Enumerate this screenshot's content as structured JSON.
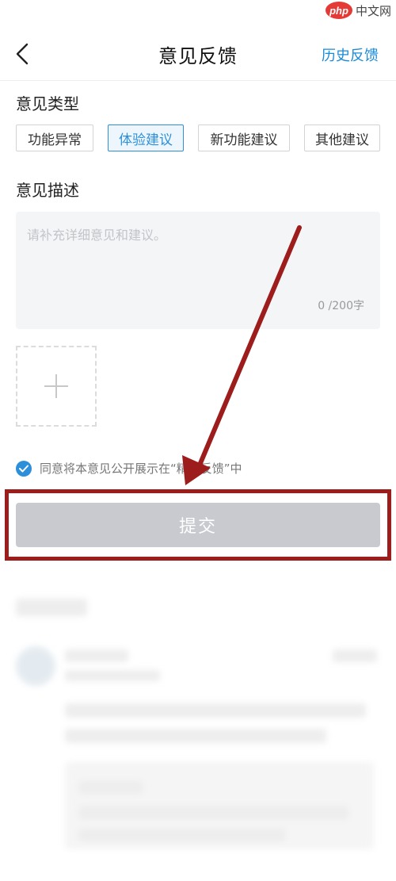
{
  "watermark": {
    "logo": "php",
    "text": "中文网"
  },
  "header": {
    "title": "意见反馈",
    "history_label": "历史反馈"
  },
  "feedback_type": {
    "label": "意见类型",
    "options": [
      {
        "label": "功能异常",
        "selected": false
      },
      {
        "label": "体验建议",
        "selected": true
      },
      {
        "label": "新功能建议",
        "selected": false
      },
      {
        "label": "其他建议",
        "selected": false
      }
    ]
  },
  "description": {
    "label": "意见描述",
    "placeholder": "请补充详细意见和建议。",
    "value": "",
    "counter": "0 /200字"
  },
  "agreement": {
    "checked": true,
    "text": "同意将本意见公开展示在“精选反馈”中"
  },
  "submit": {
    "label": "提交"
  },
  "colors": {
    "accent": "#2d8fd9",
    "highlight_frame": "#9d1c1c",
    "submit_disabled": "#c9cad0"
  },
  "icons": {
    "back": "chevron-left-icon",
    "add": "plus-icon",
    "check": "check-circle-icon"
  }
}
